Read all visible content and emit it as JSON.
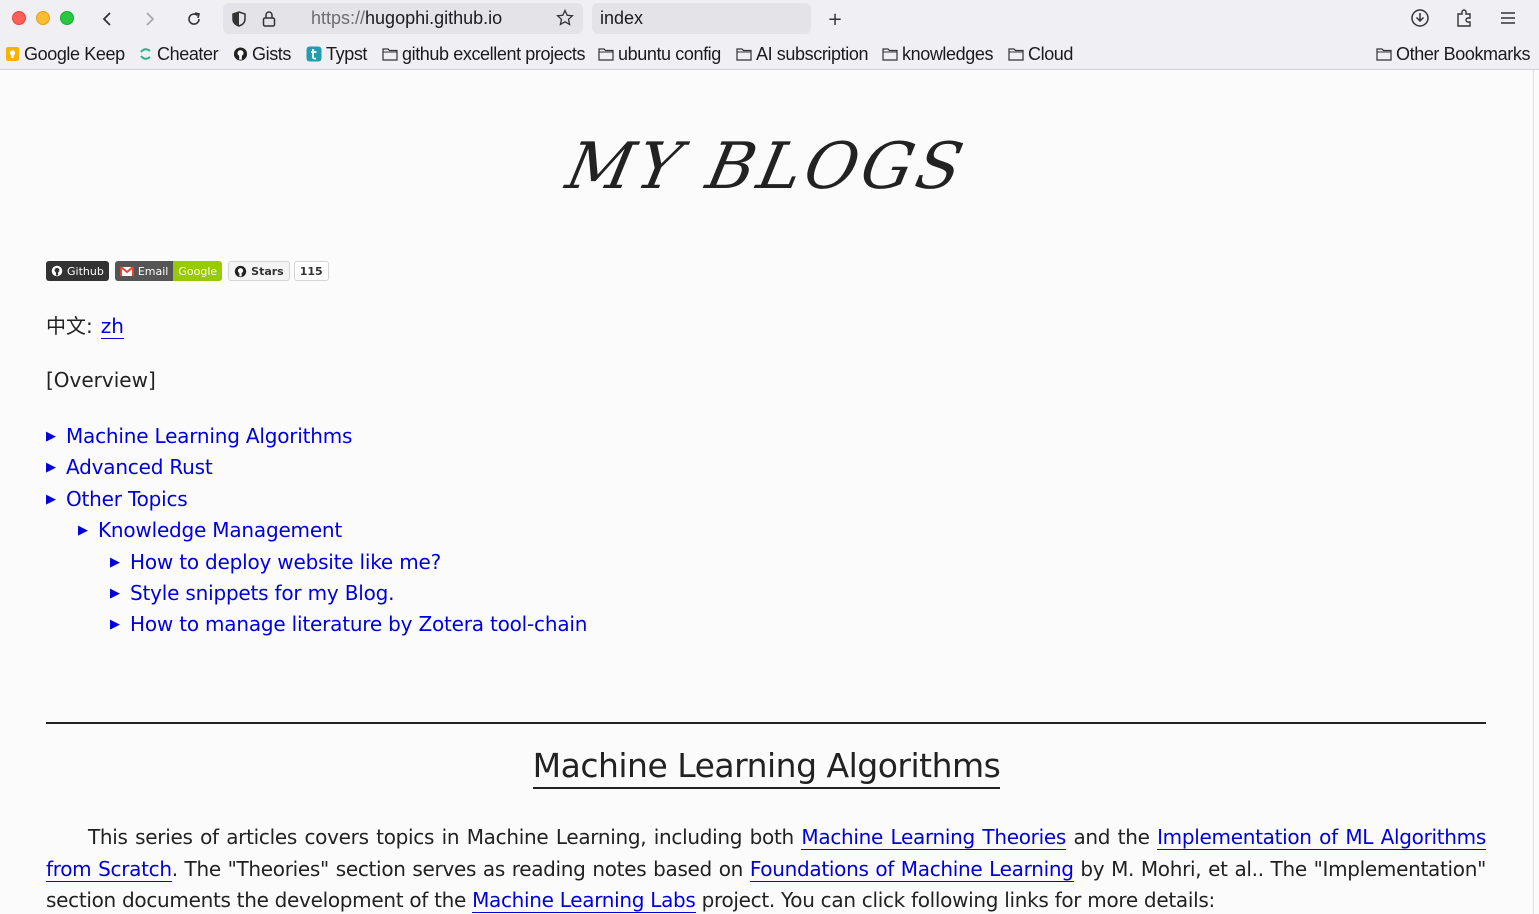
{
  "browser": {
    "url_protocol": "https://",
    "url_host": "hugophi.github.io",
    "tab_title": "index",
    "new_tab_glyph": "+"
  },
  "bookmarks": [
    {
      "label": "Google Keep",
      "icon": "keep-icon"
    },
    {
      "label": "Cheater",
      "icon": "cheater-icon"
    },
    {
      "label": "Gists",
      "icon": "github-icon"
    },
    {
      "label": "Typst",
      "icon": "typst-icon"
    },
    {
      "label": "github excellent projects",
      "icon": "folder-icon"
    },
    {
      "label": "ubuntu config",
      "icon": "folder-icon"
    },
    {
      "label": "AI subscription",
      "icon": "folder-icon"
    },
    {
      "label": "knowledges",
      "icon": "folder-icon"
    },
    {
      "label": "Cloud",
      "icon": "folder-icon"
    }
  ],
  "other_bookmarks": "Other Bookmarks",
  "page": {
    "title": "MY BLOGS",
    "badges": {
      "github": "Github",
      "email_left": "Email",
      "email_right": "Google",
      "stars_label": "Stars",
      "stars_count": "115"
    },
    "zh_label": "中文:",
    "zh_link": "zh",
    "overview": "[Overview]",
    "toc": [
      {
        "label": "Machine Learning Algorithms",
        "level": 0
      },
      {
        "label": "Advanced Rust",
        "level": 0
      },
      {
        "label": "Other Topics",
        "level": 0
      },
      {
        "label": "Knowledge Management",
        "level": 1
      },
      {
        "label": "How to deploy website like me?",
        "level": 2
      },
      {
        "label": "Style snippets for my Blog.",
        "level": 2
      },
      {
        "label": "How to manage literature by Zotera tool-chain",
        "level": 2
      }
    ],
    "section_title": "Machine Learning Algorithms",
    "paragraph": {
      "t1": "This series of articles covers topics in Machine Learning, including both ",
      "l1": "Machine Learning Theories",
      "t2": " and the ",
      "l2": "Implementation of ML Algorithms from Scratch",
      "t3": ". The \"Theories\" section serves as reading notes based on ",
      "l3": "Foundations of Machine Learning",
      "t4": " by M. Mohri, et al.. The \"Implementation\" section documents the development of the ",
      "l4": "Machine Learning Labs",
      "t5": " project.  You can click following links for more details:"
    }
  },
  "colors": {
    "link": "#0000dd",
    "chrome": "#f0f0f4",
    "page_bg": "#fbfbfb"
  }
}
